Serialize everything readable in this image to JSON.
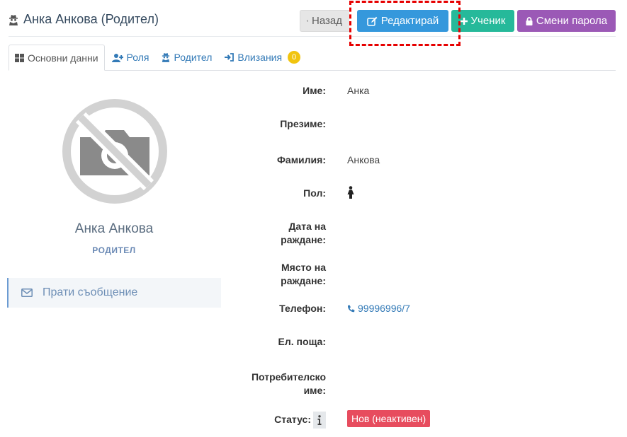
{
  "header": {
    "title": "Анка Анкова (Родител)",
    "buttons": {
      "back": "Назад",
      "edit": "Редактирай",
      "student": "Ученик",
      "change_password": "Смени парола"
    }
  },
  "tabs": [
    {
      "label": "Основни данни",
      "icon": "grid-icon",
      "active": true
    },
    {
      "label": "Роля",
      "icon": "user-plus-icon",
      "active": false
    },
    {
      "label": "Родител",
      "icon": "user-secret-icon",
      "active": false
    },
    {
      "label": "Влизания",
      "icon": "sign-in-icon",
      "active": false,
      "badge": "0"
    }
  ],
  "profile": {
    "name": "Анка Анкова",
    "role": "РОДИТЕЛ",
    "send_message": "Прати съобщение"
  },
  "fields": {
    "first_name": {
      "label": "Име:",
      "value": "Анка"
    },
    "middle_name": {
      "label": "Презиме:",
      "value": ""
    },
    "last_name": {
      "label": "Фамилия:",
      "value": "Анкова"
    },
    "gender": {
      "label": "Пол:",
      "icon": "female-icon"
    },
    "birth_date": {
      "label_line1": "Дата на",
      "label_line2": "раждане:",
      "value": ""
    },
    "birth_place": {
      "label_line1": "Място на",
      "label_line2": "раждане:",
      "value": ""
    },
    "phone": {
      "label": "Телефон:",
      "value": "99996996/7"
    },
    "email": {
      "label": "Ел. поща:",
      "value": ""
    },
    "username": {
      "label_line1": "Потребителско",
      "label_line2": "име:",
      "value": ""
    },
    "status": {
      "label": "Статус:",
      "value": "Нов (неактивен)"
    }
  },
  "colors": {
    "edit": "#3598dc",
    "student": "#26b99a",
    "password": "#9b59b6",
    "status": "#e74c5e",
    "badge": "#f1c40f",
    "highlight": "#e60000"
  }
}
